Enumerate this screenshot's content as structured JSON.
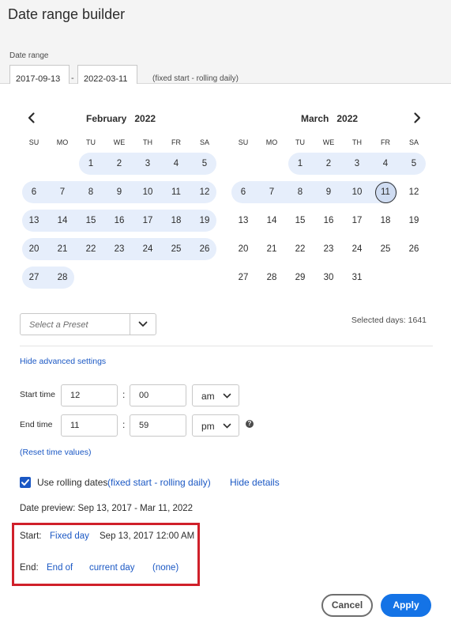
{
  "app": {
    "title": "Date range builder"
  },
  "range": {
    "label": "Date range",
    "start_value": "2017-09-13",
    "separator": "-",
    "end_value": "2022-03-11",
    "description": "(fixed start - rolling daily)"
  },
  "calendar": {
    "weekdays": [
      "SU",
      "MO",
      "TU",
      "WE",
      "TH",
      "FR",
      "SA"
    ],
    "left": {
      "month": "February",
      "year": "2022",
      "weeks": [
        [
          "",
          "",
          "1",
          "2",
          "3",
          "4",
          "5"
        ],
        [
          "6",
          "7",
          "8",
          "9",
          "10",
          "11",
          "12"
        ],
        [
          "13",
          "14",
          "15",
          "16",
          "17",
          "18",
          "19"
        ],
        [
          "20",
          "21",
          "22",
          "23",
          "24",
          "25",
          "26"
        ],
        [
          "27",
          "28",
          "",
          "",
          "",
          "",
          ""
        ]
      ]
    },
    "right": {
      "month": "March",
      "year": "2022",
      "weeks": [
        [
          "",
          "",
          "1",
          "2",
          "3",
          "4",
          "5"
        ],
        [
          "6",
          "7",
          "8",
          "9",
          "10",
          "11",
          "12"
        ],
        [
          "13",
          "14",
          "15",
          "16",
          "17",
          "18",
          "19"
        ],
        [
          "20",
          "21",
          "22",
          "23",
          "24",
          "25",
          "26"
        ],
        [
          "27",
          "28",
          "29",
          "30",
          "31",
          "",
          ""
        ]
      ],
      "today": "11"
    },
    "prev_icon": "chevron-left-icon",
    "next_icon": "chevron-right-icon"
  },
  "preset": {
    "placeholder": "Select a Preset",
    "icon": "chevron-down-icon"
  },
  "selected_days": "Selected days: 1641",
  "advanced": {
    "toggle_label": "Hide advanced settings",
    "start_time_label": "Start time",
    "start_hour": "12",
    "start_minute": "00",
    "start_ampm": "am",
    "end_time_label": "End time",
    "end_hour": "11",
    "end_minute": "59",
    "end_ampm": "pm",
    "colon": ":",
    "help_icon": "help-circle-icon",
    "help_glyph": "?",
    "reset_label": "(Reset time values)"
  },
  "rolling": {
    "checked": true,
    "label": "Use rolling dates",
    "description": "(fixed start - rolling daily)",
    "hide_details": "Hide details"
  },
  "preview": "Date preview: Sep 13, 2017 - Mar 11, 2022",
  "details": {
    "start_label": "Start:",
    "start_type": "Fixed day",
    "start_value": "Sep 13, 2017 12:00 AM",
    "end_label": "End:",
    "end_type": "End of",
    "end_period": "current day",
    "end_offset": "(none)"
  },
  "buttons": {
    "cancel": "Cancel",
    "apply": "Apply"
  },
  "colors": {
    "accent": "#1473e6",
    "link": "#1b58c4",
    "range_highlight": "#e6eefb",
    "annotation_box": "#d0202a"
  }
}
